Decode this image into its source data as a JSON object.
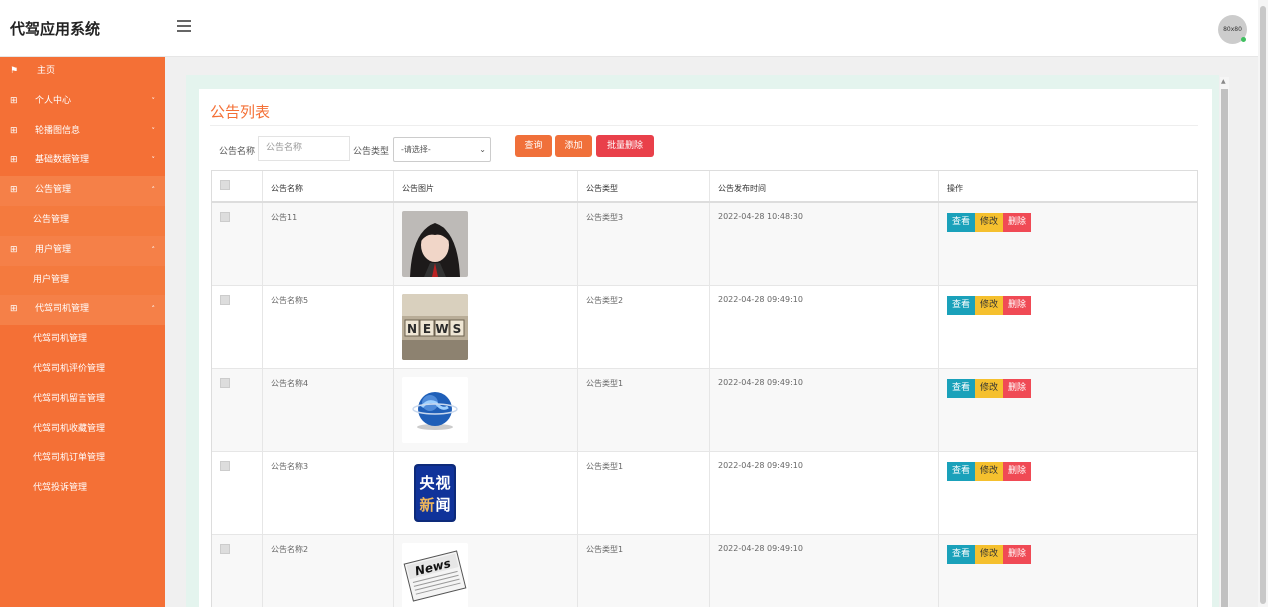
{
  "app": {
    "title": "代驾应用系统",
    "avatar_text": "80x80"
  },
  "sidebar": {
    "items": [
      {
        "label": "主页",
        "icon": "flag-icon",
        "type": "item"
      },
      {
        "label": "个人中心",
        "icon": "grid-icon",
        "type": "group",
        "open": false
      },
      {
        "label": "轮播图信息",
        "icon": "grid-icon",
        "type": "group",
        "open": false
      },
      {
        "label": "基础数据管理",
        "icon": "grid-icon",
        "type": "group",
        "open": false
      },
      {
        "label": "公告管理",
        "icon": "grid-icon",
        "type": "group",
        "open": true
      },
      {
        "label": "公告管理",
        "type": "sub",
        "active": true
      },
      {
        "label": "用户管理",
        "icon": "grid-icon",
        "type": "group",
        "open": true
      },
      {
        "label": "用户管理",
        "type": "sub",
        "active": true
      },
      {
        "label": "代驾司机管理",
        "icon": "grid-icon",
        "type": "group",
        "open": true
      },
      {
        "label": "代驾司机管理",
        "type": "sub",
        "active": false
      },
      {
        "label": "代驾司机评价管理",
        "type": "sub",
        "active": false
      },
      {
        "label": "代驾司机留言管理",
        "type": "sub",
        "active": false
      },
      {
        "label": "代驾司机收藏管理",
        "type": "sub",
        "active": false
      },
      {
        "label": "代驾司机订单管理",
        "type": "sub",
        "active": false
      },
      {
        "label": "代驾投诉管理",
        "type": "sub",
        "active": false
      }
    ]
  },
  "panel": {
    "title": "公告列表"
  },
  "filters": {
    "name_label": "公告名称",
    "name_placeholder": "公告名称",
    "type_label": "公告类型",
    "type_selected": "-请选择-",
    "search_btn": "查询",
    "add_btn": "添加",
    "batch_delete_btn": "批量删除"
  },
  "table": {
    "headers": [
      "公告名称",
      "公告图片",
      "公告类型",
      "公告发布时间",
      "操作"
    ],
    "actions": {
      "view": "查看",
      "edit": "修改",
      "delete": "删除"
    },
    "rows": [
      {
        "name": "公告11",
        "image": "portrait-photo",
        "type": "公告类型3",
        "time": "2022-04-28 10:48:30"
      },
      {
        "name": "公告名称5",
        "image": "news-blocks-photo",
        "type": "公告类型2",
        "time": "2022-04-28 09:49:10"
      },
      {
        "name": "公告名称4",
        "image": "globe-news-logo",
        "type": "公告类型1",
        "time": "2022-04-28 09:49:10"
      },
      {
        "name": "公告名称3",
        "image": "cctv-news-logo",
        "type": "公告类型1",
        "time": "2022-04-28 09:49:10"
      },
      {
        "name": "公告名称2",
        "image": "newspaper-photo",
        "type": "公告类型1",
        "time": "2022-04-28 09:49:10"
      }
    ]
  },
  "colors": {
    "accent": "#f47036",
    "view": "#1aa1ba",
    "edit": "#f5c02e",
    "delete": "#f04a55"
  }
}
